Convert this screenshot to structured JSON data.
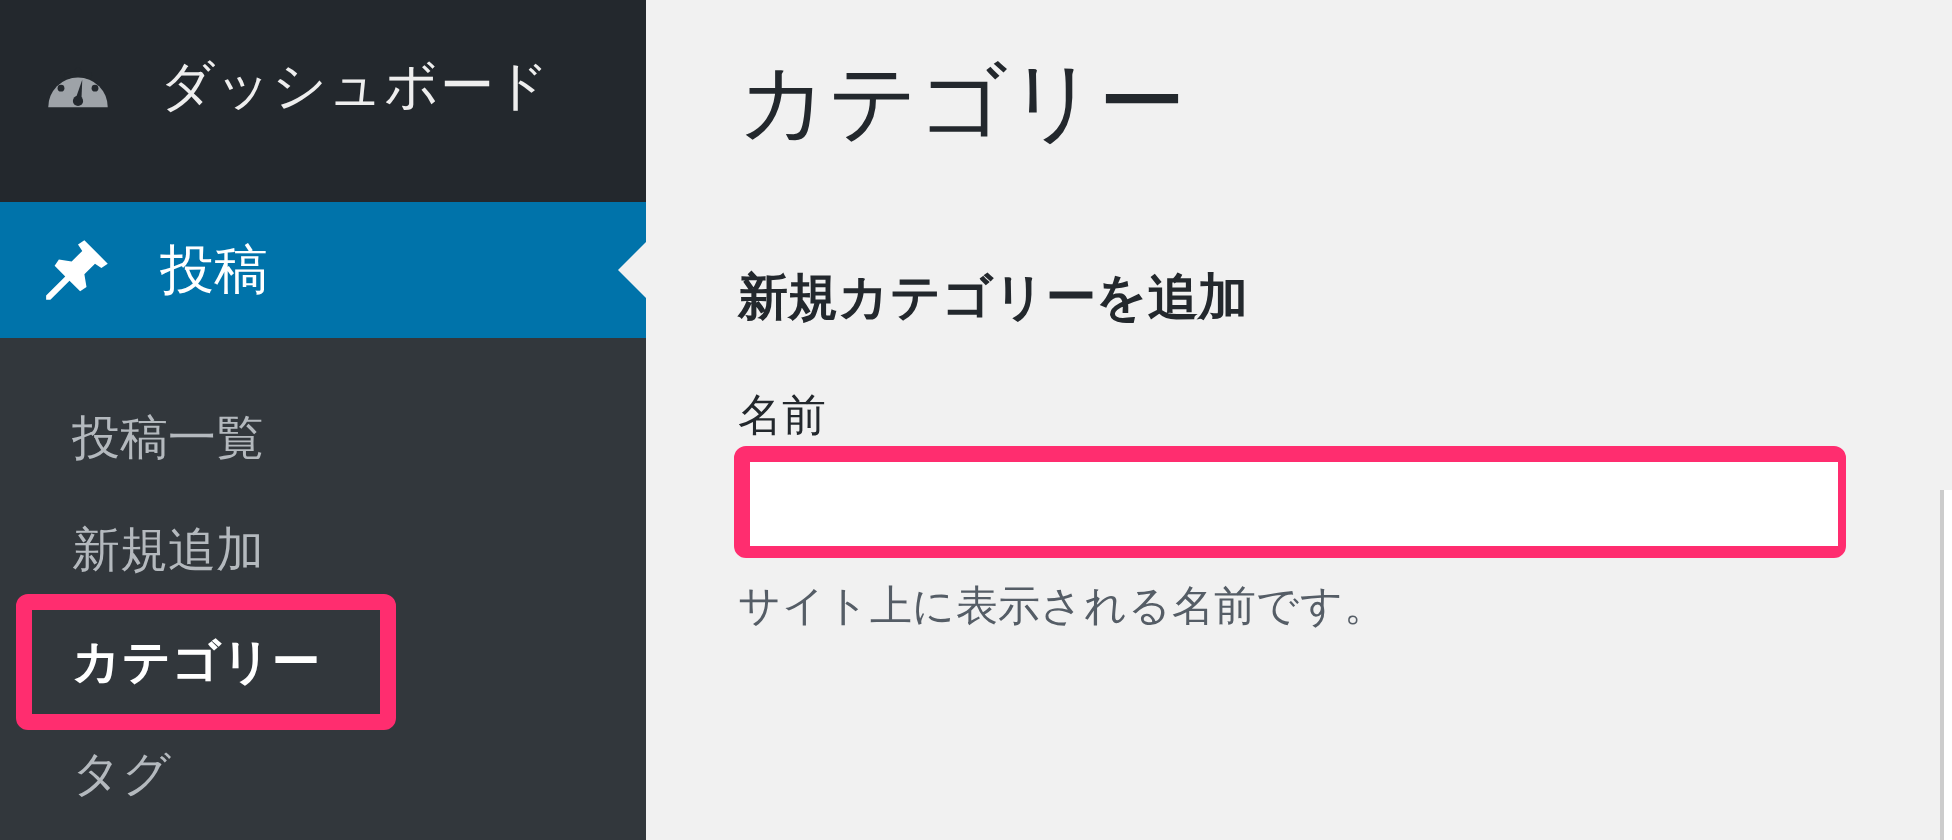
{
  "sidebar": {
    "items": [
      {
        "kind": "dashboard",
        "label": "ダッシュボード",
        "selected": false
      },
      {
        "kind": "posts",
        "label": "投稿",
        "selected": true
      }
    ],
    "submenu": [
      {
        "label": "投稿一覧",
        "selected": false,
        "highlighted": false
      },
      {
        "label": "新規追加",
        "selected": false,
        "highlighted": false
      },
      {
        "label": "カテゴリー",
        "selected": true,
        "highlighted": true
      },
      {
        "label": "タグ",
        "selected": false,
        "highlighted": false
      }
    ]
  },
  "main": {
    "title": "カテゴリー",
    "section_title": "新規カテゴリーを追加",
    "field": {
      "label": "名前",
      "highlighted": true,
      "help": "サイト上に表示される名前です。"
    }
  }
}
